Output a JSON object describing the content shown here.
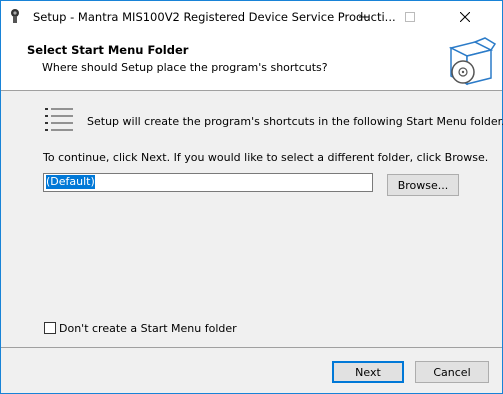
{
  "window": {
    "title": "Setup - Mantra MIS100V2 Registered Device Service Producti...",
    "accent": "#1883d7"
  },
  "header": {
    "title": "Select Start Menu Folder",
    "subtitle": "Where should Setup place the program's shortcuts?"
  },
  "body": {
    "info_text": "Setup will create the program's shortcuts in the following Start Menu folder.",
    "continue_text": "To continue, click Next. If you would like to select a different folder, click Browse.",
    "folder_value": "(Default)",
    "browse_label": "Browse...",
    "no_folder_label": "Don't create a Start Menu folder",
    "no_folder_checked": false
  },
  "footer": {
    "next_label": "Next",
    "cancel_label": "Cancel"
  }
}
